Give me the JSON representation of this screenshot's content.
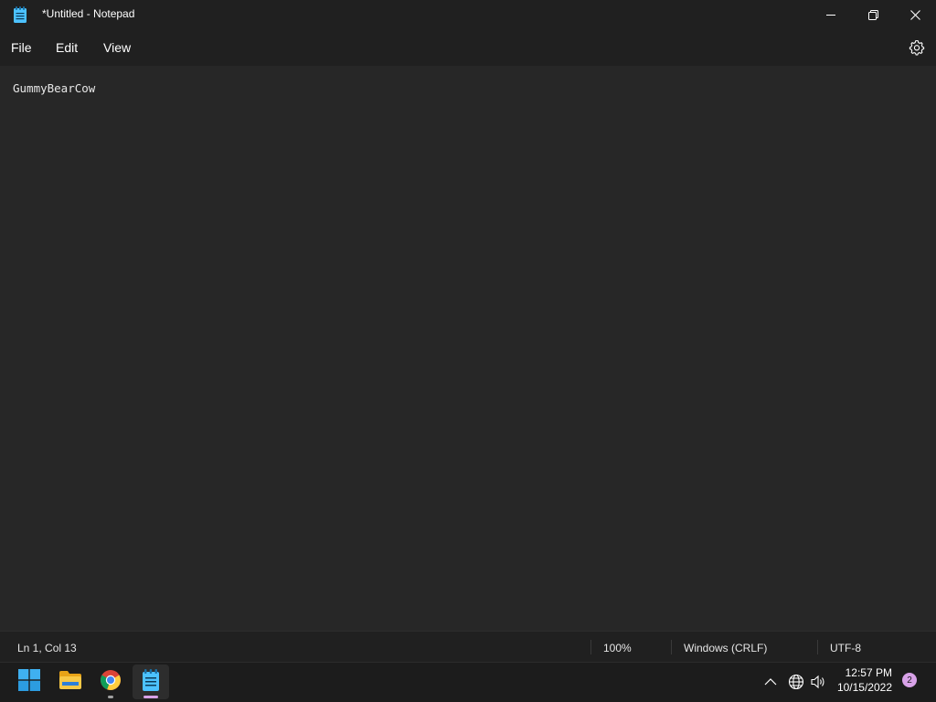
{
  "window": {
    "title": "*Untitled - Notepad",
    "icon": "notepad-icon",
    "controls": [
      "minimize-icon",
      "maximize-icon",
      "close-icon"
    ]
  },
  "menu": {
    "file": "File",
    "edit": "Edit",
    "view": "View",
    "settings_icon": "gear-icon"
  },
  "editor": {
    "content": "GummyBearCow"
  },
  "status": {
    "position": "Ln 1, Col 13",
    "zoom": "100%",
    "line_ending": "Windows (CRLF)",
    "encoding": "UTF-8"
  },
  "taskbar": {
    "apps": [
      "windows-start-icon",
      "file-explorer-icon",
      "chrome-icon",
      "notepad-icon"
    ],
    "tray": [
      "chevron-up-icon",
      "network-icon",
      "volume-icon"
    ],
    "time": "12:57 PM",
    "date": "10/15/2022",
    "notifications": "2"
  },
  "colors": {
    "background": "#272727",
    "chrome": "#202020",
    "taskbar": "#1c1c1c",
    "accent": "#4cc2ff",
    "badge": "#d8a2e8"
  }
}
